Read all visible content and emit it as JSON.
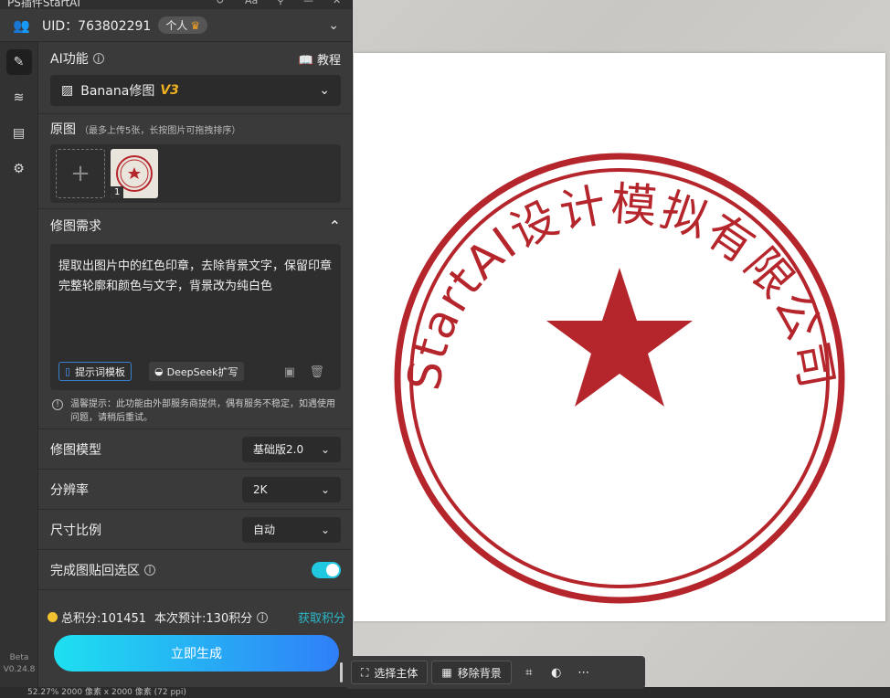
{
  "window": {
    "title": "PS插件StartAI"
  },
  "account": {
    "uid_text": "UID：763802291",
    "tier_label": "个人"
  },
  "sidebar": {
    "version_line1": "Beta",
    "version_line2": "V0.24.8"
  },
  "ai_function": {
    "label": "AI功能",
    "tutorial_label": "教程",
    "selected_name": "Banana修图",
    "selected_version": "V3"
  },
  "source_images": {
    "label": "原图",
    "hint": "（最多上传5张，长按图片可拖拽排序）",
    "add_symbol": "+",
    "items": [
      {
        "index": "1"
      }
    ]
  },
  "requirement": {
    "label": "修图需求",
    "text": "提取出图片中的红色印章，去除背景文字，保留印章完整轮廓和颜色与文字，背景改为纯白色",
    "template_button": "提示词模板",
    "deepseek_button": "DeepSeek扩写",
    "notice": "温馨提示：此功能由外部服务商提供，偶有服务不稳定，如遇使用问题，请稍后重试。"
  },
  "options": {
    "model_label": "修图模型",
    "model_value": "基础版2.0",
    "resolution_label": "分辨率",
    "resolution_value": "2K",
    "ratio_label": "尺寸比例",
    "ratio_value": "自动",
    "paste_back_label": "完成图贴回选区",
    "paste_back_enabled": true
  },
  "footer": {
    "total_points": "总积分:101451",
    "estimate": "本次预计:130积分",
    "get_points": "获取积分",
    "generate_button": "立即生成"
  },
  "canvas_toolbar": {
    "select_subject": "选择主体",
    "remove_background": "移除背景"
  },
  "stamp": {
    "ring_text": "StartAI设计模拟有限公司",
    "color": "#b5262c"
  },
  "status_bar": {
    "text": "52.27%   2000 像素 x 2000 像素 (72 ppi)"
  },
  "colors": {
    "accent": "#20c8e0",
    "gold": "#f0b020",
    "panel": "#3a3a3a"
  }
}
